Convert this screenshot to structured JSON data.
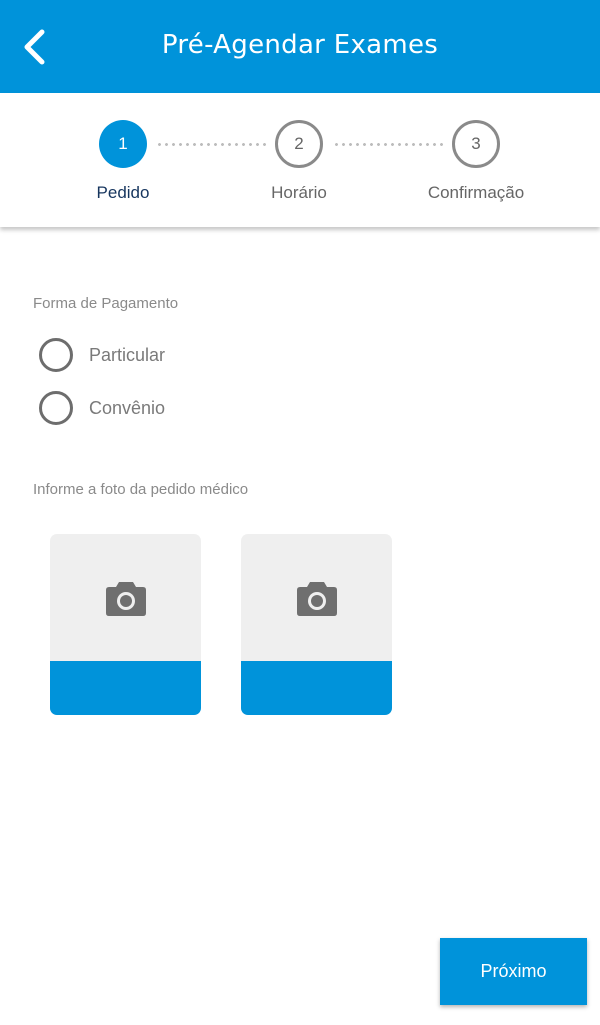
{
  "header": {
    "title": "Pré-Agendar Exames",
    "back_icon": "chevron-left-icon",
    "background": "#0093DA"
  },
  "stepper": {
    "steps": [
      {
        "number": "1",
        "label": "Pedido",
        "state": "active"
      },
      {
        "number": "2",
        "label": "Horário",
        "state": "inactive"
      },
      {
        "number": "3",
        "label": "Confirmação",
        "state": "inactive"
      }
    ]
  },
  "payment": {
    "label": "Forma de Pagamento",
    "options": [
      {
        "label": "Particular",
        "selected": false
      },
      {
        "label": "Convênio",
        "selected": false
      }
    ]
  },
  "photos": {
    "label": "Informe a foto da pedido médico",
    "slots": [
      {
        "icon": "camera-icon"
      },
      {
        "icon": "camera-icon"
      }
    ]
  },
  "footer": {
    "next_label": "Próximo"
  },
  "colors": {
    "accent": "#0093DA",
    "active_step_text": "#16355e"
  }
}
